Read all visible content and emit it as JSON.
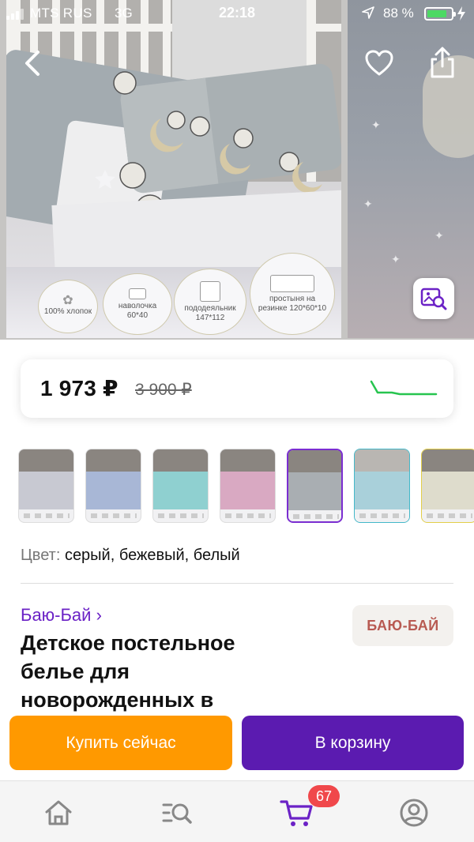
{
  "status_bar": {
    "carrier": "MTS RUS",
    "network": "3G",
    "time": "22:18",
    "battery_percent": "88 %",
    "battery_level": 0.88,
    "battery_color": "#4cd964"
  },
  "gallery": {
    "badges": [
      {
        "label": "100% хлопок",
        "icon": "cotton-icon"
      },
      {
        "label": "наволочка 60*40",
        "icon": "pillowcase-icon"
      },
      {
        "label": "пододеяльник 147*112",
        "icon": "duvet-cover-icon"
      },
      {
        "label": "простыня на резинке 120*60*10",
        "icon": "fitted-sheet-icon"
      }
    ],
    "icons": [
      "back-arrow-icon",
      "heart-icon",
      "share-icon",
      "image-search-icon"
    ]
  },
  "price": {
    "current": "1 973 ₽",
    "old": "3 900 ₽",
    "trend_color": "#27c44f"
  },
  "color_selector": {
    "label": "Цвет:",
    "value": "серый, бежевый, белый",
    "selected_index": 4,
    "accent": "#7b2ed1"
  },
  "product": {
    "brand_link": "Баю-Бай ›",
    "brand_logo_text": "БАЮ-БАЙ",
    "title_lines": [
      "Детское постельное",
      "белье для",
      "новорожденных в"
    ]
  },
  "actions": {
    "buy_now": "Купить сейчас",
    "add_to_cart": "В корзину",
    "buy_color": "#ff9900",
    "cart_color": "#5b1bb0"
  },
  "tab_bar": {
    "items": [
      "home-icon",
      "catalog-search-icon",
      "cart-icon",
      "profile-icon"
    ],
    "active": "cart-icon",
    "cart_badge": "67",
    "badge_color": "#f0484b"
  }
}
